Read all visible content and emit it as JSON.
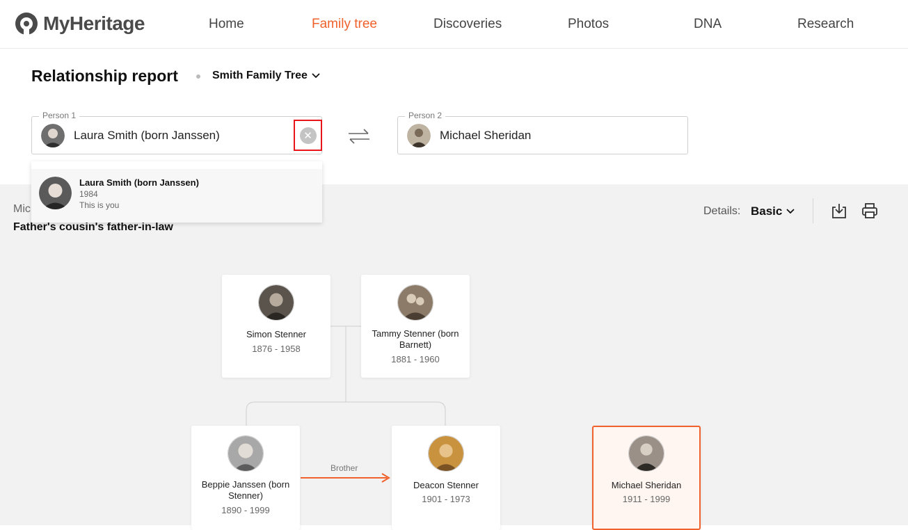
{
  "nav": {
    "logo_text": "MyHeritage",
    "items": [
      {
        "label": "Home",
        "active": false
      },
      {
        "label": "Family tree",
        "active": true
      },
      {
        "label": "Discoveries",
        "active": false
      },
      {
        "label": "Photos",
        "active": false
      },
      {
        "label": "DNA",
        "active": false
      },
      {
        "label": "Research",
        "active": false
      }
    ]
  },
  "header": {
    "title": "Relationship report",
    "tree_name": "Smith Family Tree"
  },
  "person1": {
    "legend": "Person 1",
    "value": "Laura Smith (born Janssen)"
  },
  "person2": {
    "legend": "Person 2",
    "value": "Michael Sheridan"
  },
  "dropdown": {
    "name": "Laura Smith (born Janssen)",
    "year": "1984",
    "note": "This is you"
  },
  "relationship": {
    "name_fragment": "Mic",
    "description": "Father's cousin's father-in-law"
  },
  "details": {
    "label": "Details:",
    "value": "Basic"
  },
  "tree": {
    "cards": [
      {
        "name": "Simon Stenner",
        "years": "1876 - 1958"
      },
      {
        "name": "Tammy Stenner (born Barnett)",
        "years": "1881 - 1960"
      },
      {
        "name": "Beppie Janssen (born Stenner)",
        "years": "1890 - 1999"
      },
      {
        "name": "Deacon Stenner",
        "years": "1901 - 1973"
      },
      {
        "name": "Michael Sheridan",
        "years": "1911 - 1999"
      }
    ],
    "link_label": "Brother"
  },
  "colors": {
    "accent": "#f0612b",
    "clear_highlight": "#e8151b"
  }
}
